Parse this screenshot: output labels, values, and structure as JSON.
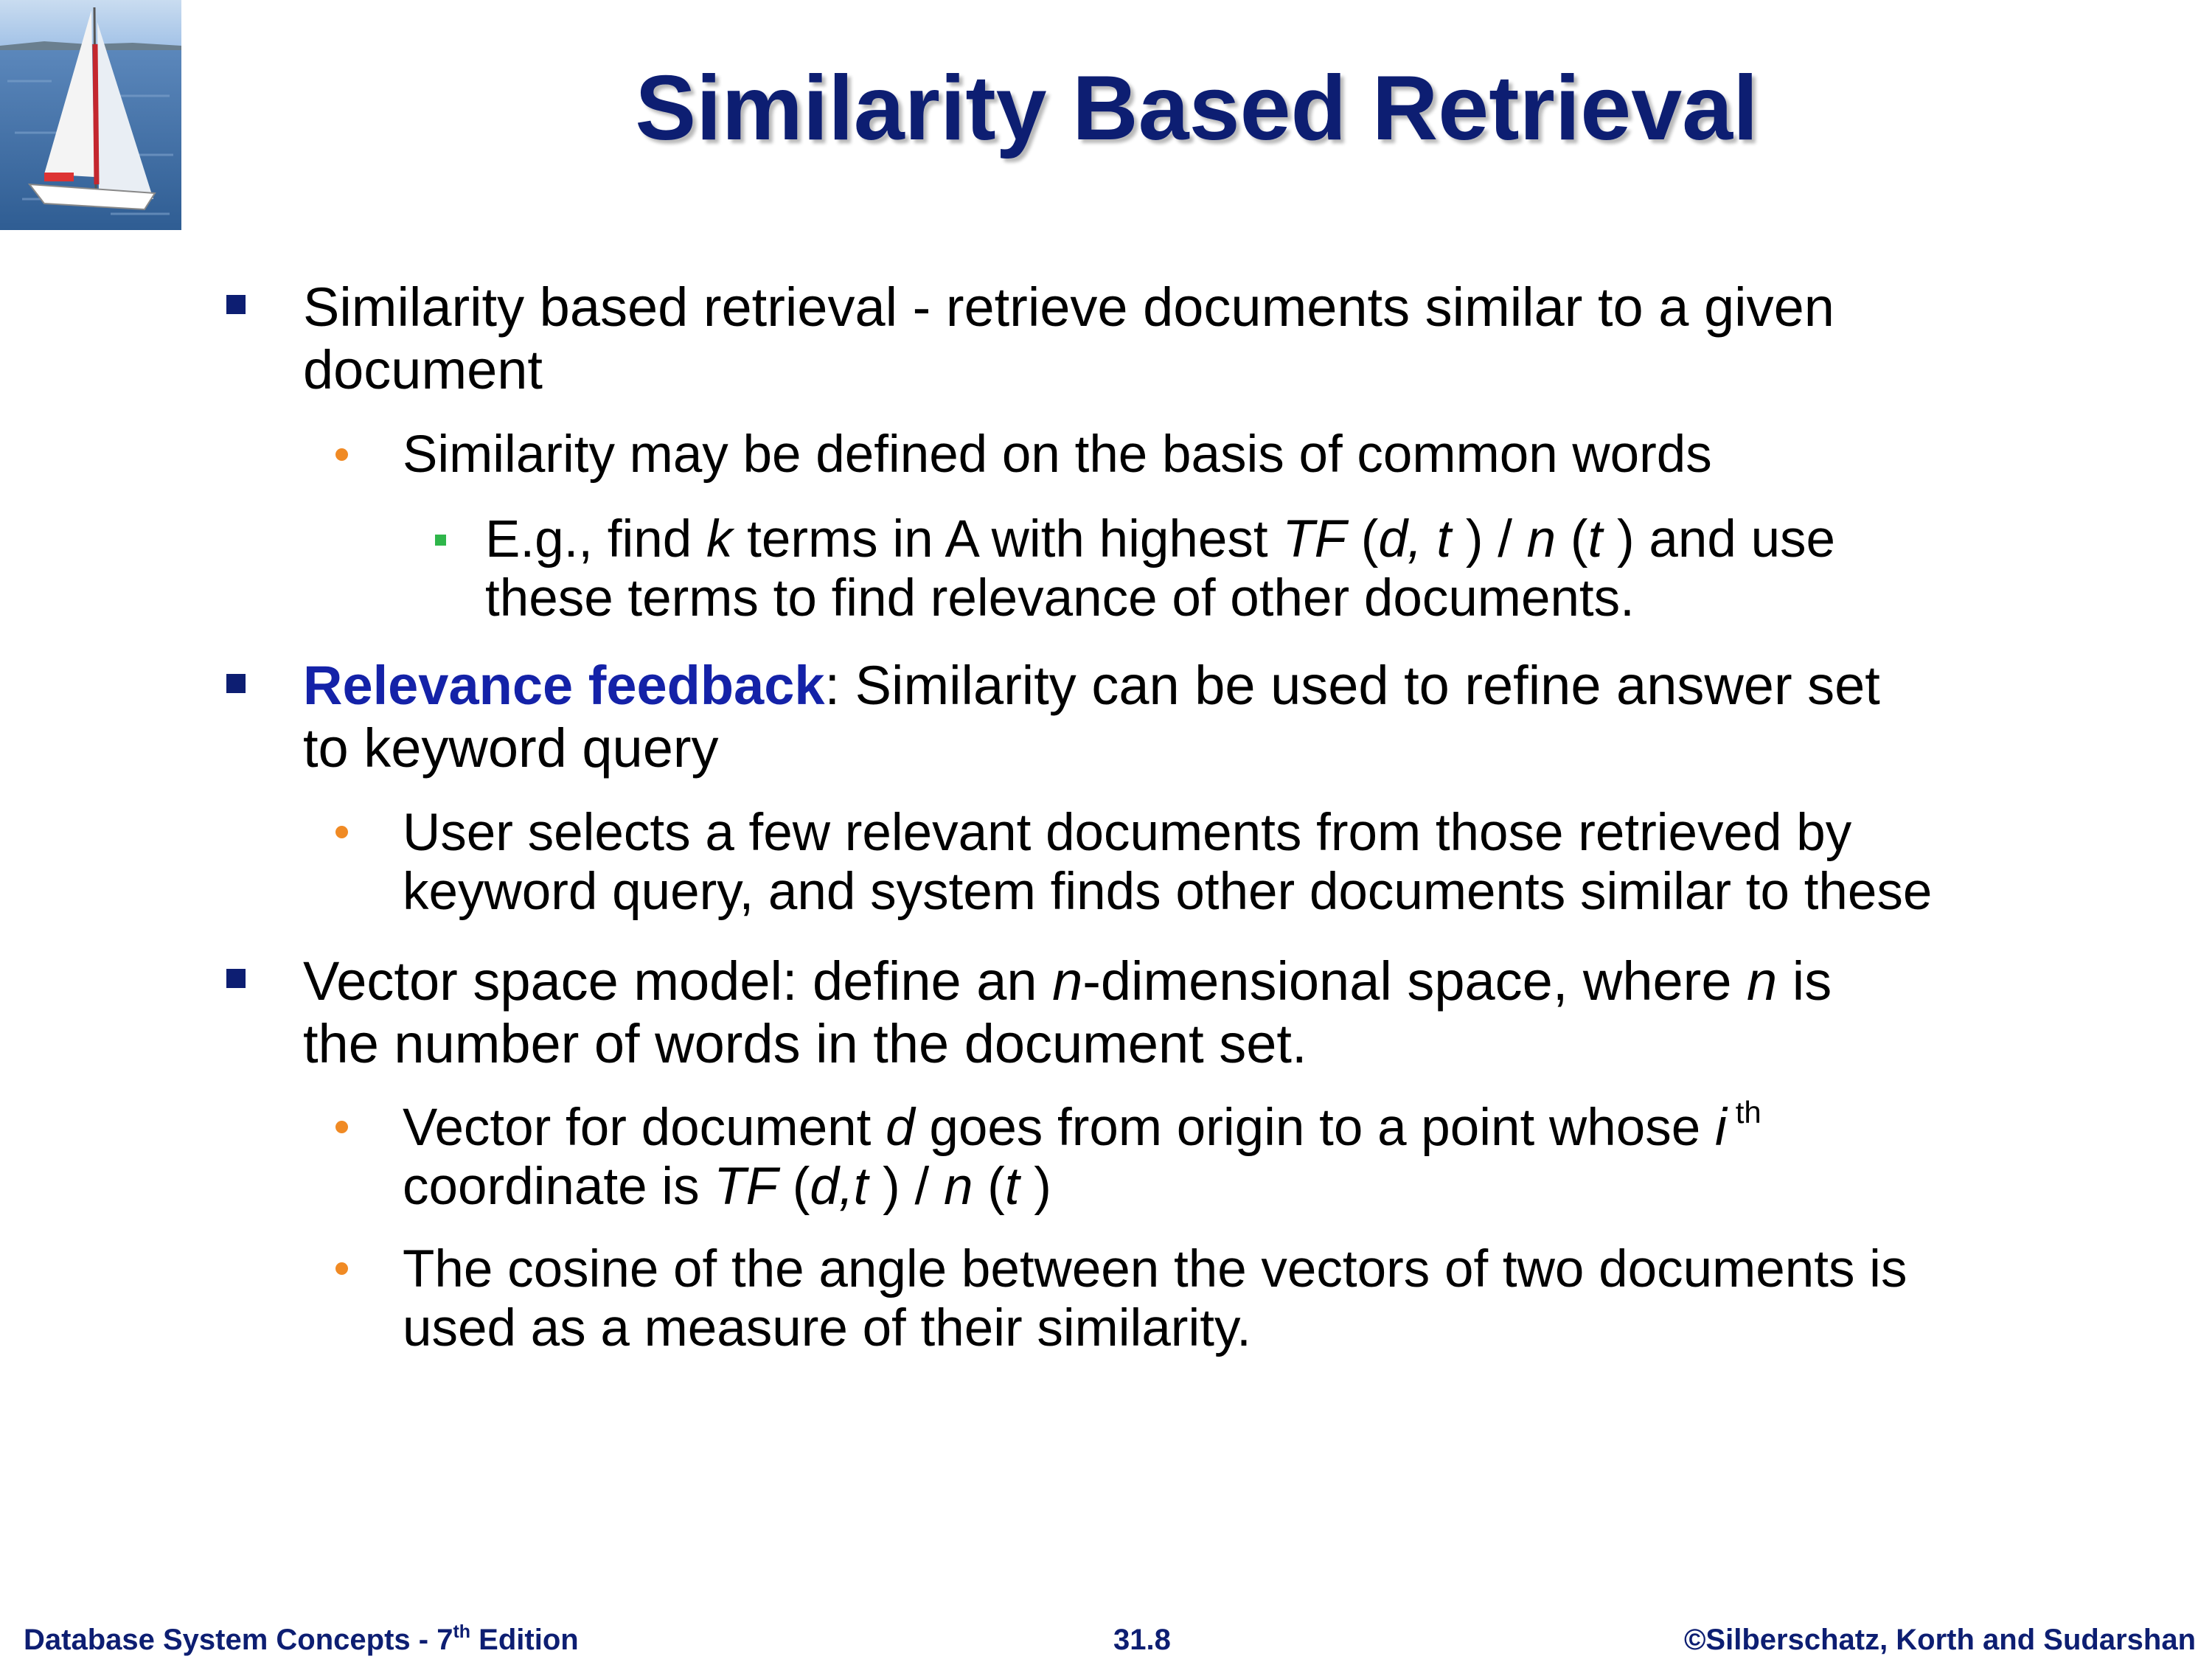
{
  "logo": {
    "icon": "sailboat-photo",
    "colors": {
      "sky": "#9fc0e6",
      "sea": "#3d6fa8",
      "sail": "#f4f4f4",
      "mast_stripe": "#c4262e"
    }
  },
  "title": "Similarity Based Retrieval",
  "b1": {
    "text": "Similarity based retrieval - retrieve documents similar to a given",
    "text2": "document",
    "sub1": "Similarity may be defined on the basis of common words",
    "sub1a": {
      "p1": "E.g., find ",
      "k": "k",
      "p2": " terms in A with highest ",
      "tf": "TF",
      "p3": " (",
      "dt": "d, t",
      "p4": " ) / ",
      "n": "n",
      "p5": " (",
      "t": "t",
      "p6": " ) and use",
      "line2": "these terms to find relevance of other documents."
    }
  },
  "b2": {
    "keyword": "Relevance feedback",
    "text": ": Similarity can be used to refine answer set",
    "text2": "to keyword query",
    "sub1_line1": "User selects a few relevant documents from those retrieved by",
    "sub1_line2": "keyword query, and system finds other documents similar to these"
  },
  "b3": {
    "p1": "Vector space model: define an ",
    "n1": "n",
    "p2": "-dimensional space, where ",
    "n2": "n",
    "p3": " is",
    "line2": "the number of words in the document set.",
    "sub1": {
      "p1": "Vector for document ",
      "d": "d",
      "p2": " goes from origin to a point whose ",
      "i": "i",
      "th": "th",
      "l2a": "coordinate is ",
      "tf": "TF",
      "l2b": " (",
      "dt": "d,t",
      "l2c": " ) / ",
      "n": "n",
      "l2d": " (",
      "t": "t",
      "l2e": " )"
    },
    "sub2_line1": "The cosine of the angle between the vectors of two documents is",
    "sub2_line2": "used as a measure of their similarity."
  },
  "footer": {
    "left_a": "Database System Concepts - 7",
    "left_sup": "th",
    "left_b": " Edition",
    "center": "31.8",
    "right": "©Silberschatz, Korth and Sudarshan"
  },
  "colors": {
    "title": "#0d1e72",
    "keyword": "#1422a8",
    "bullet_l1": "#0d1e72",
    "bullet_l2": "#f08a24",
    "bullet_l3": "#2fb64a"
  }
}
